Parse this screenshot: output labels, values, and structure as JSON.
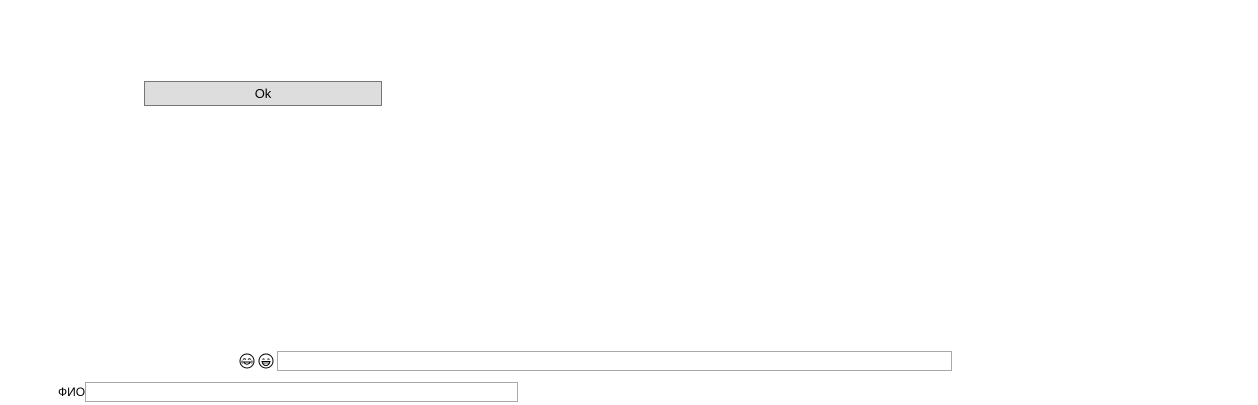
{
  "form": {
    "ok_label": "Ok",
    "emoji_input": {
      "value": "",
      "placeholder": ""
    },
    "icons": [
      "face-with-tears-of-joy-icon",
      "grinning-face-icon"
    ],
    "fio": {
      "label": "ФИО",
      "value": "",
      "placeholder": ""
    }
  }
}
